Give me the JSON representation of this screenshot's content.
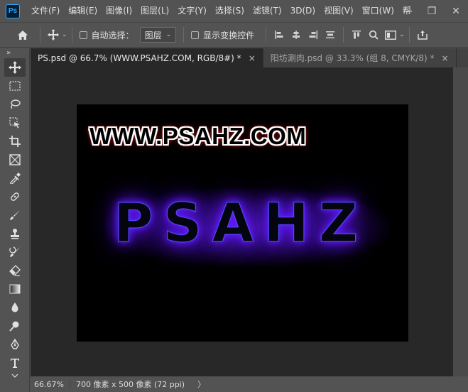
{
  "app": {
    "logo_text": "Ps"
  },
  "menu": [
    "文件(F)",
    "编辑(E)",
    "图像(I)",
    "图层(L)",
    "文字(Y)",
    "选择(S)",
    "滤镜(T)",
    "3D(D)",
    "视图(V)",
    "窗口(W)",
    "帮"
  ],
  "window_controls": {
    "minimize": "—",
    "restore": "❐",
    "close": "✕"
  },
  "options": {
    "auto_select_label": "自动选择：",
    "auto_select_value": "图层",
    "show_transform_label": "显示变换控件"
  },
  "toolbar": {
    "collapse": "»"
  },
  "tabs": [
    {
      "label": "PS.psd @ 66.7% (WWW.PSAHZ.COM, RGB/8#) *",
      "close": "×"
    },
    {
      "label": "阳坊涮肉.psd @ 33.3% (组 8, CMYK/8) *",
      "close": "×"
    }
  ],
  "document": {
    "url_text": "WWW.PSAHZ.COM",
    "big_text": "PSAHZ"
  },
  "status": {
    "zoom": "66.67%",
    "info": "700 像素 x 500 像素 (72 ppi)",
    "arrow": "〉"
  }
}
